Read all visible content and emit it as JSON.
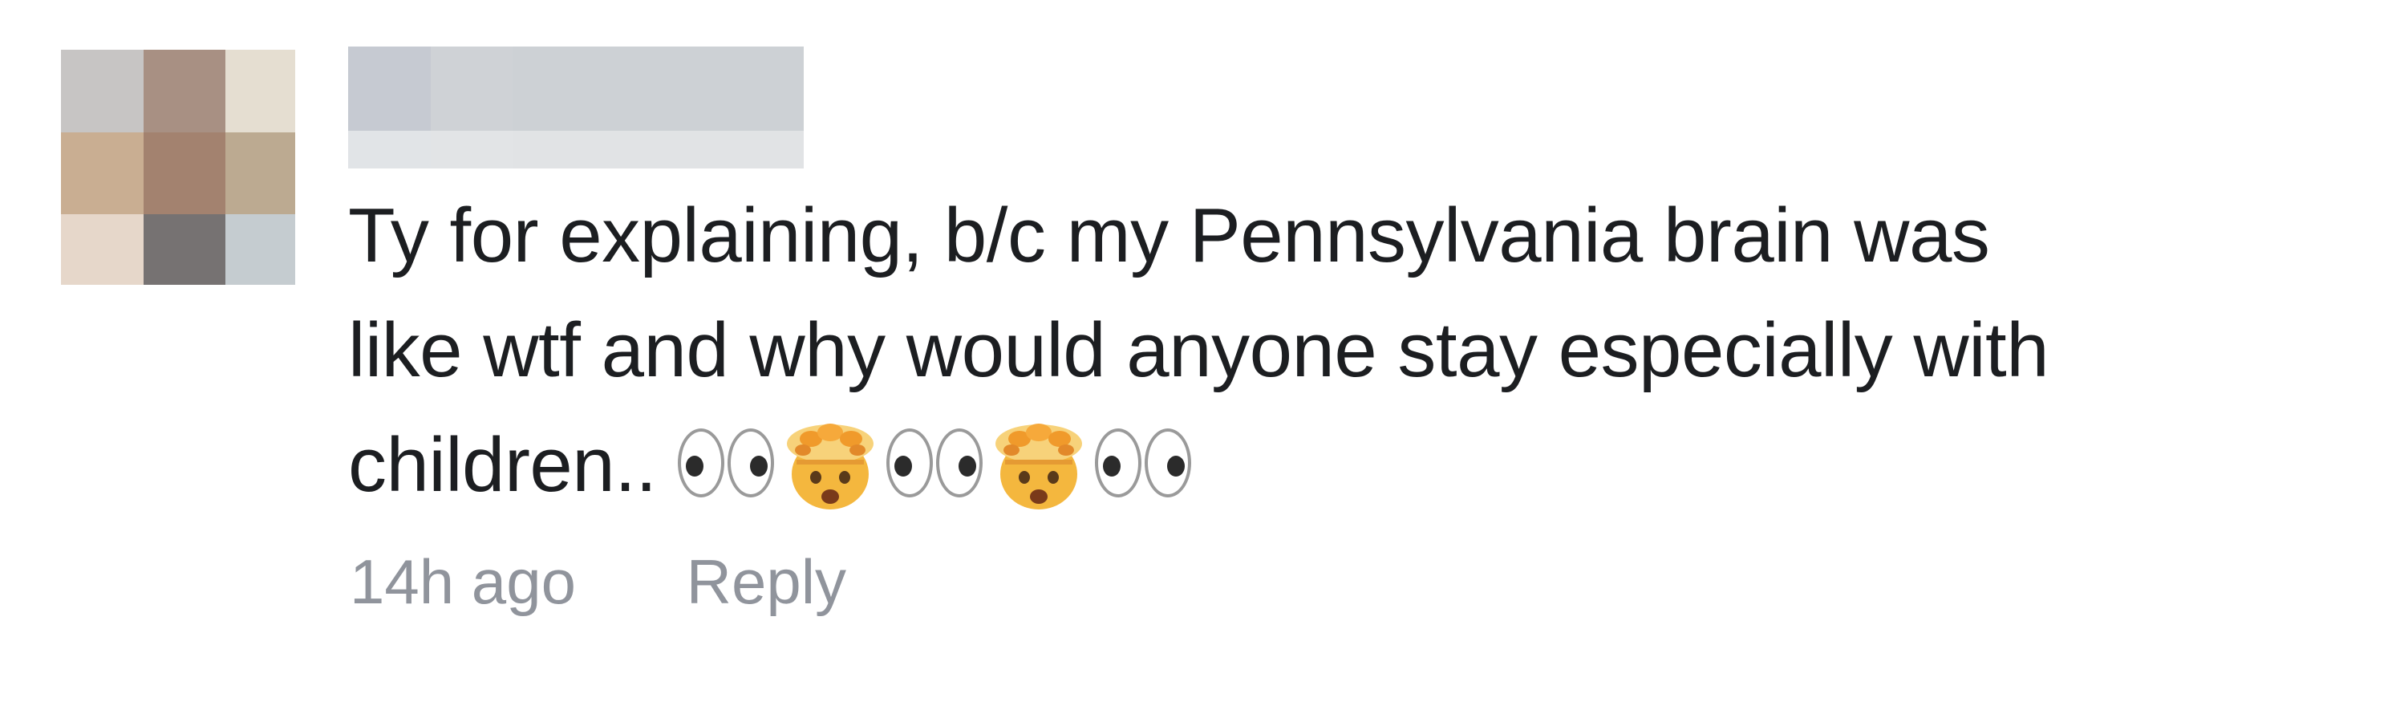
{
  "comment": {
    "author_avatar": {
      "icon": "pixelated-avatar",
      "tiles": [
        "#c7c5c4",
        "#a89083",
        "#e5ded1",
        "#c9ae92",
        "#a3826f",
        "#bcaa91",
        "#e6d7ca",
        "#767272",
        "#c5ccd0"
      ]
    },
    "author_name_blur": {
      "tiles_top": [
        "#c6cad2",
        "#cfd2d6",
        "#cdd1d5",
        "#cdd1d5",
        "#cdd1d5"
      ],
      "tiles_bottom": [
        "#e1e4e7",
        "#e2e4e6",
        "#e1e3e5",
        "#e1e3e5",
        "#e1e3e5"
      ]
    },
    "text_lines": [
      "Ty for explaining, b/c my Pennsylvania brain was",
      "like wtf and why would anyone stay especially with",
      "children.."
    ],
    "emojis": [
      "eyes-emoji",
      "exploding-head-emoji",
      "eyes-emoji",
      "exploding-head-emoji",
      "eyes-emoji"
    ],
    "timestamp": "14h ago",
    "reply_label": "Reply"
  }
}
